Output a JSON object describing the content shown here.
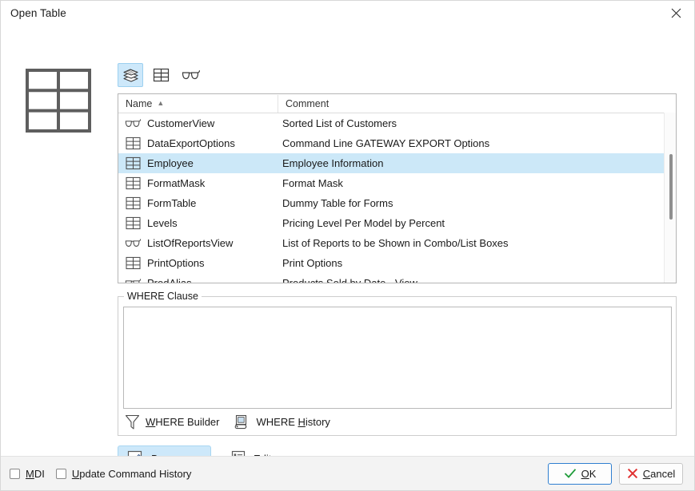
{
  "window": {
    "title": "Open Table",
    "close_icon": "close-icon"
  },
  "toolbar": {
    "buttons": [
      {
        "name": "stack-view-button",
        "icon": "layers-stack-icon",
        "selected": true
      },
      {
        "name": "table-view-button",
        "icon": "table-grid-icon",
        "selected": false
      },
      {
        "name": "views-filter-button",
        "icon": "glasses-icon",
        "selected": false
      }
    ]
  },
  "preview_icon": "table-grid-large-icon",
  "list": {
    "columns": [
      {
        "label": "Name",
        "sort": "▲"
      },
      {
        "label": "Comment",
        "sort": ""
      }
    ],
    "rows": [
      {
        "icon": "glasses-icon",
        "name": "CustomerView",
        "comment": "Sorted List of Customers",
        "selected": false
      },
      {
        "icon": "table-grid-icon",
        "name": "DataExportOptions",
        "comment": "Command Line GATEWAY EXPORT Options",
        "selected": false
      },
      {
        "icon": "table-grid-icon",
        "name": "Employee",
        "comment": "Employee Information",
        "selected": true
      },
      {
        "icon": "table-grid-icon",
        "name": "FormatMask",
        "comment": "Format Mask",
        "selected": false
      },
      {
        "icon": "table-grid-icon",
        "name": "FormTable",
        "comment": "Dummy Table for Forms",
        "selected": false
      },
      {
        "icon": "table-grid-icon",
        "name": "Levels",
        "comment": "Pricing Level Per Model by Percent",
        "selected": false
      },
      {
        "icon": "glasses-icon",
        "name": "ListOfReportsView",
        "comment": "List of Reports to be Shown in Combo/List Boxes",
        "selected": false
      },
      {
        "icon": "table-grid-icon",
        "name": "PrintOptions",
        "comment": "Print Options",
        "selected": false
      },
      {
        "icon": "glasses-icon",
        "name": "ProdAlias",
        "comment": "Products Sold by Date - View",
        "selected": false
      }
    ],
    "scrollbar": "vertical-scrollbar"
  },
  "where_clause": {
    "group_label": "WHERE Clause",
    "value": "",
    "placeholder": "",
    "builder_label_pre": "W",
    "builder_label_post": "HERE Builder",
    "builder_icon": "funnel-icon",
    "history_label_pre": "WHERE ",
    "history_label_mid": "H",
    "history_label_post": "istory",
    "history_icon": "scroll-history-icon"
  },
  "actions": {
    "browse_pre": "B",
    "browse_post": "rowse",
    "browse_icon": "pencil-edit-icon",
    "edit_pre": "E",
    "edit_post": "dit",
    "edit_icon": "list-lines-icon"
  },
  "footer": {
    "mdi_pre": "M",
    "mdi_post": "DI",
    "mdi_checked": false,
    "update_pre": "U",
    "update_post": "pdate Command History",
    "update_checked": false,
    "ok_pre": "O",
    "ok_post": "K",
    "ok_icon": "green-check-icon",
    "cancel_pre": "C",
    "cancel_post": "ancel",
    "cancel_icon": "red-x-icon"
  },
  "colors": {
    "selection": "#cce8f8",
    "accent": "#2f7fd0",
    "ok_check": "#1f9c3a",
    "cancel_x": "#e03131"
  }
}
